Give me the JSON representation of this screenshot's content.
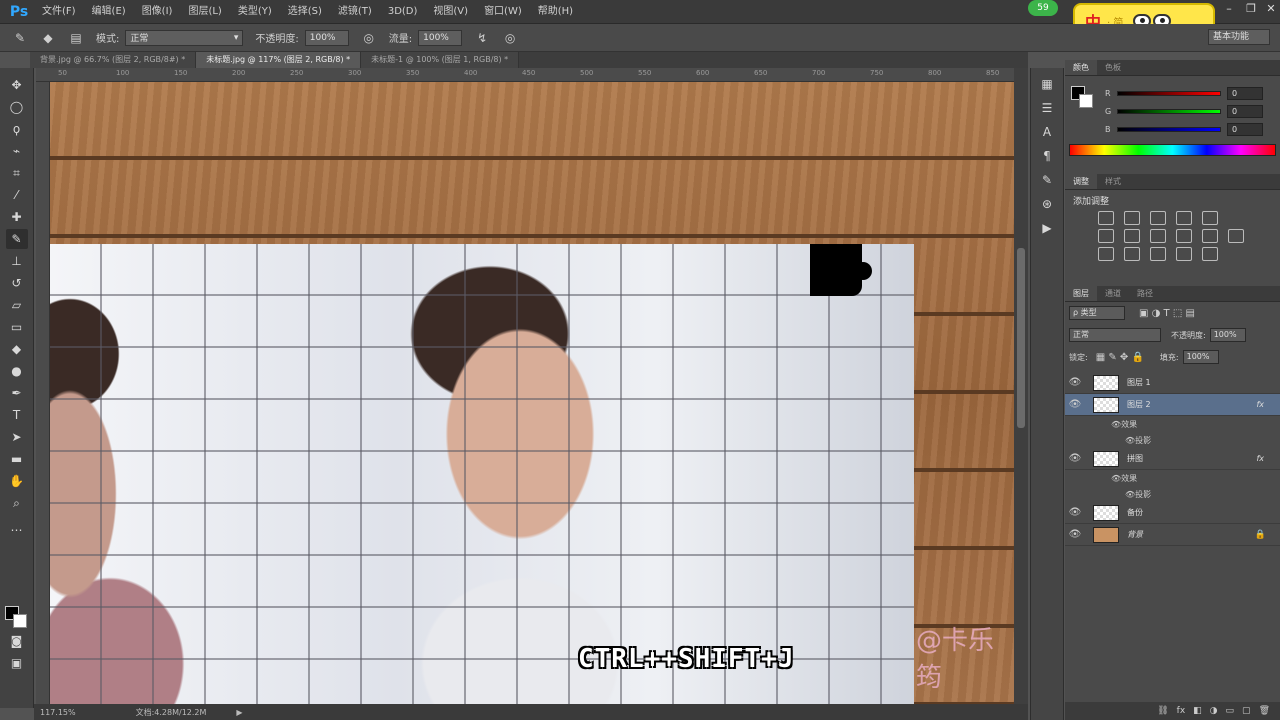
{
  "app": {
    "logo": "Ps"
  },
  "menu": [
    "文件(F)",
    "编辑(E)",
    "图像(I)",
    "图层(L)",
    "类型(Y)",
    "选择(S)",
    "滤镜(T)",
    "3D(D)",
    "视图(V)",
    "窗口(W)",
    "帮助(H)"
  ],
  "badge": "59",
  "ime": {
    "main": "中",
    "sub": "· 简"
  },
  "options": {
    "mode_label": "模式:",
    "mode_value": "正常",
    "opacity_label": "不透明度:",
    "opacity_value": "100%",
    "flow_label": "流量:",
    "flow_value": "100%",
    "workspace": "基本功能"
  },
  "tabs": [
    "背景.jpg @ 66.7% (图层 2, RGB/8#) *",
    "未标题.jpg @ 117% (图层 2, RGB/8) *",
    "未标题-1 @ 100% (图层 1, RGB/8) *"
  ],
  "ruler": [
    "50",
    "100",
    "150",
    "200",
    "250",
    "300",
    "350",
    "400",
    "450",
    "500",
    "550",
    "600",
    "650",
    "700",
    "750",
    "800",
    "850"
  ],
  "canvas": {
    "shortcut": "CTRL++SHIFT+J",
    "watermark": "@卡乐筠"
  },
  "status": {
    "zoom": "117.15%",
    "doc": "文档:4.28M/12.2M"
  },
  "color_panel": {
    "tabs": [
      "颜色",
      "色板"
    ],
    "channels": [
      {
        "label": "R",
        "value": "0",
        "gradient": "#ff0000"
      },
      {
        "label": "G",
        "value": "0",
        "gradient": "#00ff00"
      },
      {
        "label": "B",
        "value": "0",
        "gradient": "#0000ff"
      }
    ]
  },
  "adjust_panel": {
    "tabs": [
      "调整",
      "样式"
    ],
    "title": "添加调整"
  },
  "layers_panel": {
    "tabs": [
      "图层",
      "通道",
      "路径"
    ],
    "kind": "类型",
    "blend": "正常",
    "opacity_label": "不透明度:",
    "opacity_value": "100%",
    "lock_label": "锁定:",
    "fill_label": "填充:",
    "fill_value": "100%",
    "layers": [
      {
        "name": "图层 1",
        "fx": "",
        "effects": []
      },
      {
        "name": "图层 2",
        "fx": "fx",
        "effects": [
          "效果",
          "投影"
        ],
        "selected": true
      },
      {
        "name": "拼图",
        "fx": "fx",
        "effects": [
          "效果",
          "投影"
        ]
      },
      {
        "name": "备份",
        "fx": "",
        "effects": []
      },
      {
        "name": "背景",
        "fx": "",
        "effects": [],
        "locked": true
      }
    ]
  }
}
